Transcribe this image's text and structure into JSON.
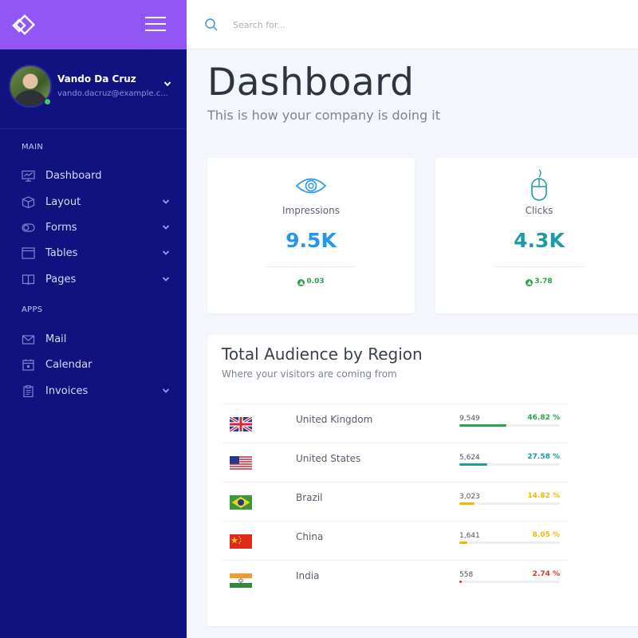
{
  "sidebar": {
    "user": {
      "name": "Vando Da Cruz",
      "email": "vando.dacruz@example.c..."
    },
    "sections": [
      {
        "title": "MAIN",
        "items": [
          {
            "label": "Dashboard",
            "icon": "dashboard-icon",
            "has_submenu": false
          },
          {
            "label": "Layout",
            "icon": "cube-icon",
            "has_submenu": true
          },
          {
            "label": "Forms",
            "icon": "toggle-icon",
            "has_submenu": true
          },
          {
            "label": "Tables",
            "icon": "table-icon",
            "has_submenu": true
          },
          {
            "label": "Pages",
            "icon": "book-icon",
            "has_submenu": true
          }
        ]
      },
      {
        "title": "APPS",
        "items": [
          {
            "label": "Mail",
            "icon": "mail-icon",
            "has_submenu": false
          },
          {
            "label": "Calendar",
            "icon": "calendar-icon",
            "has_submenu": false
          },
          {
            "label": "Invoices",
            "icon": "clipboard-icon",
            "has_submenu": true
          }
        ]
      }
    ]
  },
  "search": {
    "placeholder": "Search for..."
  },
  "page": {
    "title": "Dashboard",
    "subtitle": "This is how your company is doing it"
  },
  "stats": [
    {
      "label": "Impressions",
      "value": "9.5K",
      "change": "0.03",
      "icon": "eye-icon",
      "color": "#2196f3"
    },
    {
      "label": "Clicks",
      "value": "4.3K",
      "change": "3.78",
      "icon": "mouse-icon",
      "color": "#1e9ba8"
    }
  ],
  "region": {
    "title": "Total Audience by Region",
    "subtitle": "Where your visitors are coming from",
    "rows": [
      {
        "country": "United Kingdom",
        "count": "9,549",
        "percent": "46.82 %",
        "fraction": 0.4682,
        "color": "#2aa14b",
        "flag": "uk"
      },
      {
        "country": "United States",
        "count": "5,624",
        "percent": "27.58 %",
        "fraction": 0.2758,
        "color": "#1e9ba8",
        "flag": "us"
      },
      {
        "country": "Brazil",
        "count": "3,023",
        "percent": "14.82 %",
        "fraction": 0.1482,
        "color": "#f5b800",
        "flag": "br"
      },
      {
        "country": "China",
        "count": "1,641",
        "percent": "8.05 %",
        "fraction": 0.0805,
        "color": "#f5b800",
        "flag": "cn"
      },
      {
        "country": "India",
        "count": "558",
        "percent": "2.74 %",
        "fraction": 0.0274,
        "color": "#e03131",
        "flag": "in"
      }
    ]
  },
  "colors": {
    "sidebar": "#10137f",
    "brand": "#9255f6",
    "background": "#f3f6fa"
  }
}
